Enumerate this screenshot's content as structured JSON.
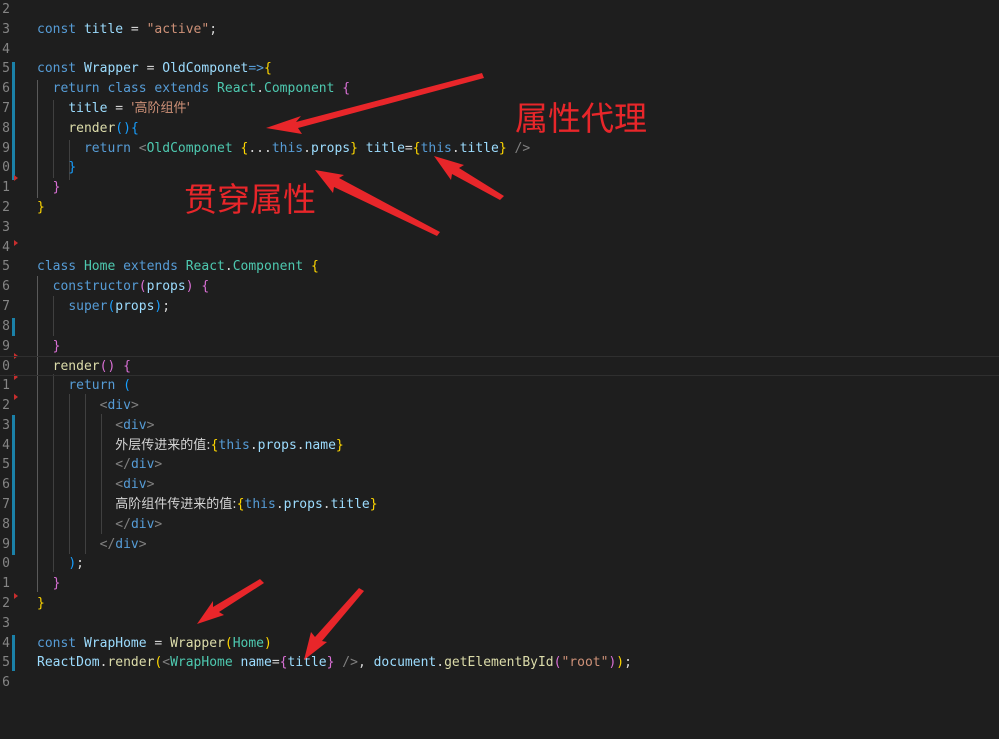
{
  "editor": {
    "line_numbers": [
      "2",
      "3",
      "4",
      "5",
      "6",
      "7",
      "8",
      "9",
      "0",
      "1",
      "2",
      "3",
      "4",
      "5",
      "6",
      "7",
      "8",
      "9",
      "0",
      "1",
      "2",
      "3",
      "4",
      "5",
      "6",
      "7",
      "8",
      "9",
      "0",
      "1",
      "2",
      "3",
      "4",
      "5",
      "6"
    ],
    "lines": [
      [],
      [
        [
          "kw",
          "const "
        ],
        [
          "var",
          "title"
        ],
        [
          "pun",
          " = "
        ],
        [
          "str",
          "\"active\""
        ],
        [
          "pun",
          ";"
        ]
      ],
      [],
      [
        [
          "kw",
          "const "
        ],
        [
          "var",
          "Wrapper"
        ],
        [
          "pun",
          " = "
        ],
        [
          "var",
          "OldComponet"
        ],
        [
          "kw",
          "=>"
        ],
        [
          "brk1",
          "{"
        ]
      ],
      [
        [
          "pun",
          "  "
        ],
        [
          "kw",
          "return "
        ],
        [
          "kw",
          "class "
        ],
        [
          "kw",
          "extends "
        ],
        [
          "cls",
          "React"
        ],
        [
          "pun",
          "."
        ],
        [
          "cls",
          "Component"
        ],
        [
          "pun",
          " "
        ],
        [
          "brk2",
          "{"
        ]
      ],
      [
        [
          "pun",
          "    "
        ],
        [
          "var",
          "title"
        ],
        [
          "pun",
          " = "
        ],
        [
          "str",
          "'高阶组件'"
        ]
      ],
      [
        [
          "pun",
          "    "
        ],
        [
          "fn",
          "render"
        ],
        [
          "brk3",
          "()"
        ],
        [
          "brk3",
          "{"
        ]
      ],
      [
        [
          "pun",
          "      "
        ],
        [
          "kw",
          "return "
        ],
        [
          "tag",
          "<"
        ],
        [
          "cls",
          "OldComponet"
        ],
        [
          "pun",
          " "
        ],
        [
          "brk1",
          "{"
        ],
        [
          "pun",
          "..."
        ],
        [
          "kw",
          "this"
        ],
        [
          "pun",
          "."
        ],
        [
          "var",
          "props"
        ],
        [
          "brk1",
          "}"
        ],
        [
          "pun",
          " "
        ],
        [
          "var",
          "title"
        ],
        [
          "pun",
          "="
        ],
        [
          "brk1",
          "{"
        ],
        [
          "kw",
          "this"
        ],
        [
          "pun",
          "."
        ],
        [
          "var",
          "title"
        ],
        [
          "brk1",
          "}"
        ],
        [
          "pun",
          " "
        ],
        [
          "tag",
          "/>"
        ]
      ],
      [
        [
          "pun",
          "    "
        ],
        [
          "brk3",
          "}"
        ]
      ],
      [
        [
          "pun",
          "  "
        ],
        [
          "brk2",
          "}"
        ]
      ],
      [
        [
          "brk1",
          "}"
        ]
      ],
      [],
      [],
      [
        [
          "kw",
          "class "
        ],
        [
          "cls",
          "Home"
        ],
        [
          "pun",
          " "
        ],
        [
          "kw",
          "extends "
        ],
        [
          "cls",
          "React"
        ],
        [
          "pun",
          "."
        ],
        [
          "cls",
          "Component"
        ],
        [
          "pun",
          " "
        ],
        [
          "brk1",
          "{"
        ]
      ],
      [
        [
          "pun",
          "  "
        ],
        [
          "kw",
          "constructor"
        ],
        [
          "brk2",
          "("
        ],
        [
          "var",
          "props"
        ],
        [
          "brk2",
          ")"
        ],
        [
          "pun",
          " "
        ],
        [
          "brk2",
          "{"
        ]
      ],
      [
        [
          "pun",
          "    "
        ],
        [
          "kw",
          "super"
        ],
        [
          "brk3",
          "("
        ],
        [
          "var",
          "props"
        ],
        [
          "brk3",
          ")"
        ],
        [
          "pun",
          ";"
        ]
      ],
      [],
      [
        [
          "pun",
          "  "
        ],
        [
          "brk2",
          "}"
        ]
      ],
      [
        [
          "pun",
          "  "
        ],
        [
          "fn",
          "render"
        ],
        [
          "brk2",
          "()"
        ],
        [
          "pun",
          " "
        ],
        [
          "brk2",
          "{"
        ]
      ],
      [
        [
          "pun",
          "    "
        ],
        [
          "kw",
          "return "
        ],
        [
          "brk3",
          "("
        ]
      ],
      [
        [
          "pun",
          "        "
        ],
        [
          "tag",
          "<"
        ],
        [
          "tagn",
          "div"
        ],
        [
          "tag",
          ">"
        ]
      ],
      [
        [
          "pun",
          "          "
        ],
        [
          "tag",
          "<"
        ],
        [
          "tagn",
          "div"
        ],
        [
          "tag",
          ">"
        ]
      ],
      [
        [
          "pun",
          "          "
        ],
        [
          "txt",
          "外层传进来的值:"
        ],
        [
          "brk1",
          "{"
        ],
        [
          "kw",
          "this"
        ],
        [
          "pun",
          "."
        ],
        [
          "var",
          "props"
        ],
        [
          "pun",
          "."
        ],
        [
          "var",
          "name"
        ],
        [
          "brk1",
          "}"
        ]
      ],
      [
        [
          "pun",
          "          "
        ],
        [
          "tag",
          "</"
        ],
        [
          "tagn",
          "div"
        ],
        [
          "tag",
          ">"
        ]
      ],
      [
        [
          "pun",
          "          "
        ],
        [
          "tag",
          "<"
        ],
        [
          "tagn",
          "div"
        ],
        [
          "tag",
          ">"
        ]
      ],
      [
        [
          "pun",
          "          "
        ],
        [
          "txt",
          "高阶组件传进来的值:"
        ],
        [
          "brk1",
          "{"
        ],
        [
          "kw",
          "this"
        ],
        [
          "pun",
          "."
        ],
        [
          "var",
          "props"
        ],
        [
          "pun",
          "."
        ],
        [
          "var",
          "title"
        ],
        [
          "brk1",
          "}"
        ]
      ],
      [
        [
          "pun",
          "          "
        ],
        [
          "tag",
          "</"
        ],
        [
          "tagn",
          "div"
        ],
        [
          "tag",
          ">"
        ]
      ],
      [
        [
          "pun",
          "        "
        ],
        [
          "tag",
          "</"
        ],
        [
          "tagn",
          "div"
        ],
        [
          "tag",
          ">"
        ]
      ],
      [
        [
          "pun",
          "    "
        ],
        [
          "brk3",
          ")"
        ],
        [
          "pun",
          ";"
        ]
      ],
      [
        [
          "pun",
          "  "
        ],
        [
          "brk2",
          "}"
        ]
      ],
      [
        [
          "brk1",
          "}"
        ]
      ],
      [],
      [
        [
          "kw",
          "const "
        ],
        [
          "var",
          "WrapHome"
        ],
        [
          "pun",
          " = "
        ],
        [
          "fn",
          "Wrapper"
        ],
        [
          "brk1",
          "("
        ],
        [
          "cls",
          "Home"
        ],
        [
          "brk1",
          ")"
        ]
      ],
      [
        [
          "var",
          "ReactDom"
        ],
        [
          "pun",
          "."
        ],
        [
          "fn",
          "render"
        ],
        [
          "brk1",
          "("
        ],
        [
          "tag",
          "<"
        ],
        [
          "cls",
          "WrapHome"
        ],
        [
          "pun",
          " "
        ],
        [
          "var",
          "name"
        ],
        [
          "pun",
          "="
        ],
        [
          "brk2",
          "{"
        ],
        [
          "var",
          "title"
        ],
        [
          "brk2",
          "}"
        ],
        [
          "pun",
          " "
        ],
        [
          "tag",
          "/>"
        ],
        [
          "pun",
          ", "
        ],
        [
          "var",
          "document"
        ],
        [
          "pun",
          "."
        ],
        [
          "fn",
          "getElementById"
        ],
        [
          "brk2",
          "("
        ],
        [
          "str",
          "\"root\""
        ],
        [
          "brk2",
          ")"
        ],
        [
          "brk1",
          ")"
        ],
        [
          "pun",
          ";"
        ]
      ],
      []
    ]
  },
  "annotations": {
    "property_proxy": "属性代理",
    "pass_through_props": "贯穿属性"
  },
  "colors": {
    "background": "#1e1e1e",
    "annotation_red": "#e8262a",
    "gutter_modified": "#1b81a8"
  }
}
